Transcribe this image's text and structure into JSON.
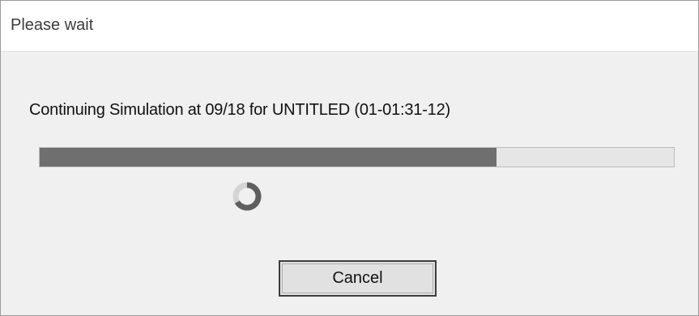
{
  "window": {
    "title": "Please wait"
  },
  "status": {
    "message": "Continuing Simulation at 09/18 for UNTITLED (01-01:31-12)"
  },
  "progress": {
    "percent": 72
  },
  "buttons": {
    "cancel_label": "Cancel"
  },
  "icons": {
    "busy": "loading-spinner-icon"
  },
  "colors": {
    "progress_fill": "#6f6f6f",
    "progress_track": "#e6e6e6",
    "dialog_background": "#f0f0f0"
  }
}
